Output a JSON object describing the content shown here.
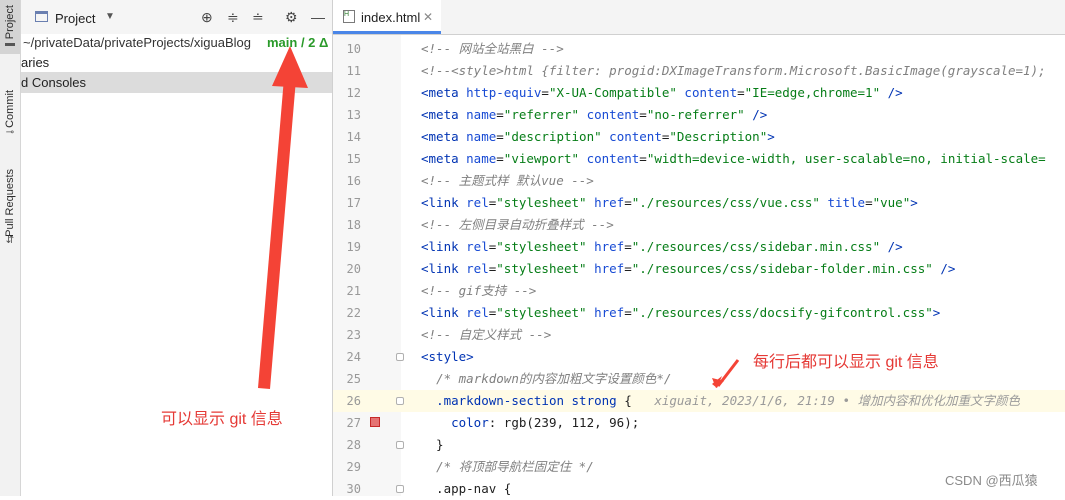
{
  "sidebar": {
    "tabs": [
      {
        "label": "Project",
        "icon": "folder-icon"
      },
      {
        "label": "Commit",
        "icon": "commit-icon"
      },
      {
        "label": "Pull Requests",
        "icon": "pull-request-icon"
      }
    ]
  },
  "project_panel": {
    "title": "Project",
    "tree": {
      "path": "~/privateData/privateProjects/xiguaBlog",
      "branch": "main / 2 Δ",
      "libraries": "aries",
      "scratches": "d Consoles"
    },
    "annotation": "可以显示 git 信息"
  },
  "editor": {
    "tab": {
      "label": "index.html"
    },
    "lines": [
      {
        "num": "10",
        "parts": [
          [
            "cm",
            "<!-- 网站全站黑白 -->"
          ]
        ]
      },
      {
        "num": "11",
        "parts": [
          [
            "cm",
            "<!--<style>html {filter: progid:DXImageTransform.Microsoft.BasicImage(grayscale=1);"
          ]
        ]
      },
      {
        "num": "12",
        "parts": [
          [
            "tg",
            "<meta "
          ],
          [
            "at",
            "http-equiv"
          ],
          [
            "pl",
            "="
          ],
          [
            "st",
            "\"X-UA-Compatible\""
          ],
          [
            "pl",
            " "
          ],
          [
            "at",
            "content"
          ],
          [
            "pl",
            "="
          ],
          [
            "st",
            "\"IE=edge,chrome=1\""
          ],
          [
            "pl",
            " "
          ],
          [
            "tg",
            "/>"
          ]
        ]
      },
      {
        "num": "13",
        "parts": [
          [
            "tg",
            "<meta "
          ],
          [
            "at",
            "name"
          ],
          [
            "pl",
            "="
          ],
          [
            "st",
            "\"referrer\""
          ],
          [
            "pl",
            " "
          ],
          [
            "at",
            "content"
          ],
          [
            "pl",
            "="
          ],
          [
            "st",
            "\"no-referrer\""
          ],
          [
            "pl",
            " "
          ],
          [
            "tg",
            "/>"
          ]
        ]
      },
      {
        "num": "14",
        "parts": [
          [
            "tg",
            "<meta "
          ],
          [
            "at",
            "name"
          ],
          [
            "pl",
            "="
          ],
          [
            "st",
            "\"description\""
          ],
          [
            "pl",
            " "
          ],
          [
            "at",
            "content"
          ],
          [
            "pl",
            "="
          ],
          [
            "st",
            "\"Description\""
          ],
          [
            "tg",
            ">"
          ]
        ]
      },
      {
        "num": "15",
        "parts": [
          [
            "tg",
            "<meta "
          ],
          [
            "at",
            "name"
          ],
          [
            "pl",
            "="
          ],
          [
            "st",
            "\"viewport\""
          ],
          [
            "pl",
            " "
          ],
          [
            "at",
            "content"
          ],
          [
            "pl",
            "="
          ],
          [
            "st",
            "\"width=device-width, user-scalable=no, initial-scale="
          ]
        ]
      },
      {
        "num": "16",
        "parts": [
          [
            "cm",
            "<!-- 主题式样 默认vue -->"
          ]
        ]
      },
      {
        "num": "17",
        "parts": [
          [
            "tg",
            "<link "
          ],
          [
            "at",
            "rel"
          ],
          [
            "pl",
            "="
          ],
          [
            "st",
            "\"stylesheet\""
          ],
          [
            "pl",
            " "
          ],
          [
            "at",
            "href"
          ],
          [
            "pl",
            "="
          ],
          [
            "st",
            "\"./resources/css/vue.css\""
          ],
          [
            "pl",
            " "
          ],
          [
            "at",
            "title"
          ],
          [
            "pl",
            "="
          ],
          [
            "st",
            "\"vue\""
          ],
          [
            "tg",
            ">"
          ]
        ]
      },
      {
        "num": "18",
        "parts": [
          [
            "cm",
            "<!-- 左侧目录自动折叠样式 -->"
          ]
        ]
      },
      {
        "num": "19",
        "parts": [
          [
            "tg",
            "<link "
          ],
          [
            "at",
            "rel"
          ],
          [
            "pl",
            "="
          ],
          [
            "st",
            "\"stylesheet\""
          ],
          [
            "pl",
            " "
          ],
          [
            "at",
            "href"
          ],
          [
            "pl",
            "="
          ],
          [
            "st",
            "\"./resources/css/sidebar.min.css\""
          ],
          [
            "pl",
            " "
          ],
          [
            "tg",
            "/>"
          ]
        ]
      },
      {
        "num": "20",
        "parts": [
          [
            "tg",
            "<link "
          ],
          [
            "at",
            "rel"
          ],
          [
            "pl",
            "="
          ],
          [
            "st",
            "\"stylesheet\""
          ],
          [
            "pl",
            " "
          ],
          [
            "at",
            "href"
          ],
          [
            "pl",
            "="
          ],
          [
            "st",
            "\"./resources/css/sidebar-folder.min.css\""
          ],
          [
            "pl",
            " "
          ],
          [
            "tg",
            "/>"
          ]
        ]
      },
      {
        "num": "21",
        "parts": [
          [
            "cm",
            "<!-- gif支持 -->"
          ]
        ]
      },
      {
        "num": "22",
        "parts": [
          [
            "tg",
            "<link "
          ],
          [
            "at",
            "rel"
          ],
          [
            "pl",
            "="
          ],
          [
            "st",
            "\"stylesheet\""
          ],
          [
            "pl",
            " "
          ],
          [
            "at",
            "href"
          ],
          [
            "pl",
            "="
          ],
          [
            "st",
            "\"./resources/css/docsify-gifcontrol.css\""
          ],
          [
            "tg",
            ">"
          ]
        ]
      },
      {
        "num": "23",
        "parts": [
          [
            "cm",
            "<!-- 自定义样式 -->"
          ]
        ]
      },
      {
        "num": "24",
        "parts": [
          [
            "tg",
            "<style>"
          ]
        ]
      },
      {
        "num": "25",
        "parts": [
          [
            "pl",
            "  "
          ],
          [
            "cm",
            "/* markdown的内容加粗文字设置颜色*/"
          ]
        ]
      },
      {
        "num": "26",
        "hl": true,
        "parts": [
          [
            "pl",
            "  "
          ],
          [
            "kw",
            ".markdown-section strong "
          ],
          [
            "pl",
            "{"
          ],
          [
            "pl",
            "   "
          ],
          [
            "blame",
            "xiguait, 2023/1/6, 21:19 • 增加内容和优化加重文字颜色"
          ]
        ]
      },
      {
        "num": "27",
        "parts": [
          [
            "pl",
            "    "
          ],
          [
            "kw",
            "color"
          ],
          [
            "pl",
            ": rgb(239, 112, 96);"
          ]
        ]
      },
      {
        "num": "28",
        "parts": [
          [
            "pl",
            "  }"
          ]
        ]
      },
      {
        "num": "29",
        "parts": [
          [
            "pl",
            "  "
          ],
          [
            "cm",
            "/* 将顶部导航栏固定住 */"
          ]
        ]
      },
      {
        "num": "30",
        "parts": [
          [
            "pl",
            "  .app-nav {"
          ]
        ]
      }
    ],
    "annotation": "每行后都可以显示 git 信息"
  },
  "watermark": "CSDN @西瓜猿",
  "colors": {
    "annotation": "#e53935",
    "branch": "#2a9a2a",
    "tag": "#0033b3",
    "string": "#067d17"
  }
}
